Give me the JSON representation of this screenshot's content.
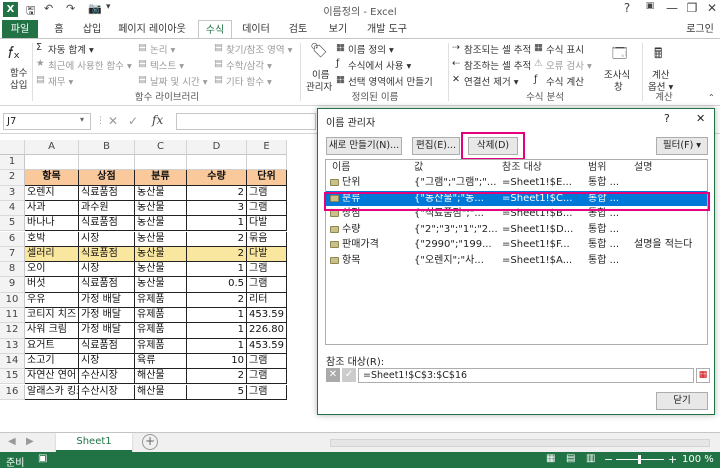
{
  "window": {
    "title": "이름정의 - Excel",
    "help": "?",
    "min": "—",
    "restore": "❐",
    "close": "✕",
    "user": "로그인"
  },
  "tabs": [
    "파일",
    "홈",
    "삽입",
    "페이지 레이아웃",
    "수식",
    "데이터",
    "검토",
    "보기",
    "개발 도구"
  ],
  "ribbon": {
    "fx_label1": "함수",
    "fx_label2": "삽입",
    "lib_items": [
      "자동 합계 ▾",
      "최근에 사용한 함수 ▾",
      "재무 ▾",
      "논리 ▾",
      "텍스트 ▾",
      "날짜 및 시간 ▾",
      "찾기/참조 영역 ▾",
      "수학/삼각 ▾",
      "기타 함수 ▾"
    ],
    "lib_group": "함수 라이브러리",
    "nm_label1": "이름",
    "nm_label2": "관리자",
    "nm_items": [
      "이름 정의 ▾",
      "수식에서 사용 ▾",
      "선택 영역에서 만들기"
    ],
    "nm_group": "정의된 이름",
    "audit_items": [
      "참조되는 셀 추적",
      "참조하는 셀 추적",
      "연결선 제거 ▾",
      "수식 표시",
      "오류 검사 ▾",
      "수식 계산"
    ],
    "watch_label1": "조사식",
    "watch_label2": "창",
    "audit_group": "수식 분석",
    "calc_label1": "계산",
    "calc_label2": "옵션 ▾",
    "calc_group": "계산"
  },
  "formula_bar": {
    "name_box": "J7",
    "cancel": "✕",
    "enter": "✓",
    "fx": "fx"
  },
  "columns": [
    "A",
    "B",
    "C",
    "D",
    "E"
  ],
  "rows": [
    [
      "",
      "",
      "",
      "",
      ""
    ],
    [
      "항목",
      "상점",
      "분류",
      "수량",
      "단위"
    ],
    [
      "오렌지",
      "식료품점",
      "농산물",
      "2",
      "그램"
    ],
    [
      "사과",
      "과수원",
      "농산물",
      "3",
      "그램"
    ],
    [
      "바나나",
      "식료품점",
      "농산물",
      "1",
      "다발"
    ],
    [
      "호박",
      "시장",
      "농산물",
      "2",
      "묶음"
    ],
    [
      "셀러리",
      "식료품점",
      "농산물",
      "2",
      "다발"
    ],
    [
      "오이",
      "시장",
      "농산물",
      "1",
      "그램"
    ],
    [
      "버섯",
      "식료품점",
      "농산물",
      "0.5",
      "그램"
    ],
    [
      "우유",
      "가정 배달",
      "유제품",
      "2",
      "리터"
    ],
    [
      "코티지 치즈",
      "가정 배달",
      "유제품",
      "1",
      "453.59"
    ],
    [
      "사워 크림",
      "가정 배달",
      "유제품",
      "1",
      "226.80"
    ],
    [
      "요거트",
      "식료품점",
      "유제품",
      "1",
      "453.59"
    ],
    [
      "소고기",
      "시장",
      "육류",
      "10",
      "그램"
    ],
    [
      "자연산 연어",
      "수산시장",
      "해산물",
      "2",
      "그램"
    ],
    [
      "알래스카 킹크랩",
      "수산시장",
      "해산물",
      "5",
      "그램"
    ]
  ],
  "sheet": {
    "tab": "Sheet1",
    "add": "+"
  },
  "status": {
    "ready": "준비",
    "zoom": "100 %"
  },
  "dialog": {
    "title": "이름 관리자",
    "help": "?",
    "close": "✕",
    "new_btn": "새로 만들기(N)...",
    "edit_btn": "편집(E)...",
    "delete_btn": "삭제(D)",
    "filter_btn": "필터(F) ▾",
    "headers": [
      "이름",
      "값",
      "참조 대상",
      "범위",
      "설명"
    ],
    "items": [
      {
        "name": "단위",
        "value": "{\"그램\";\"그램\";\"...",
        "ref": "=Sheet1!$E...",
        "scope": "통합 ...",
        "desc": ""
      },
      {
        "name": "분류",
        "value": "{\"농산물\";\"농...",
        "ref": "=Sheet1!$C...",
        "scope": "통합 ...",
        "desc": ""
      },
      {
        "name": "상점",
        "value": "{\"식료품점\";\"...",
        "ref": "=Sheet1!$B...",
        "scope": "통합 ...",
        "desc": ""
      },
      {
        "name": "수량",
        "value": "{\"2\";\"3\";\"1\";\"2...",
        "ref": "=Sheet1!$D...",
        "scope": "통합 ...",
        "desc": ""
      },
      {
        "name": "판매가격",
        "value": "{\"2990\";\"199...",
        "ref": "=Sheet1!$F...",
        "scope": "통합 ...",
        "desc": "설명을 적는다"
      },
      {
        "name": "항목",
        "value": "{\"오렌지\";\"사...",
        "ref": "=Sheet1!$A...",
        "scope": "통합 ...",
        "desc": ""
      }
    ],
    "ref_label": "참조 대상(R):",
    "ref_value": "=Sheet1!$C$3:$C$16",
    "close_btn": "닫기"
  },
  "colors": {
    "excel_green": "#217346",
    "selection": "#0078d7",
    "highlight": "#e6007e",
    "header_fill": "#f9c89b",
    "cell_fill": "#f9e79f"
  }
}
